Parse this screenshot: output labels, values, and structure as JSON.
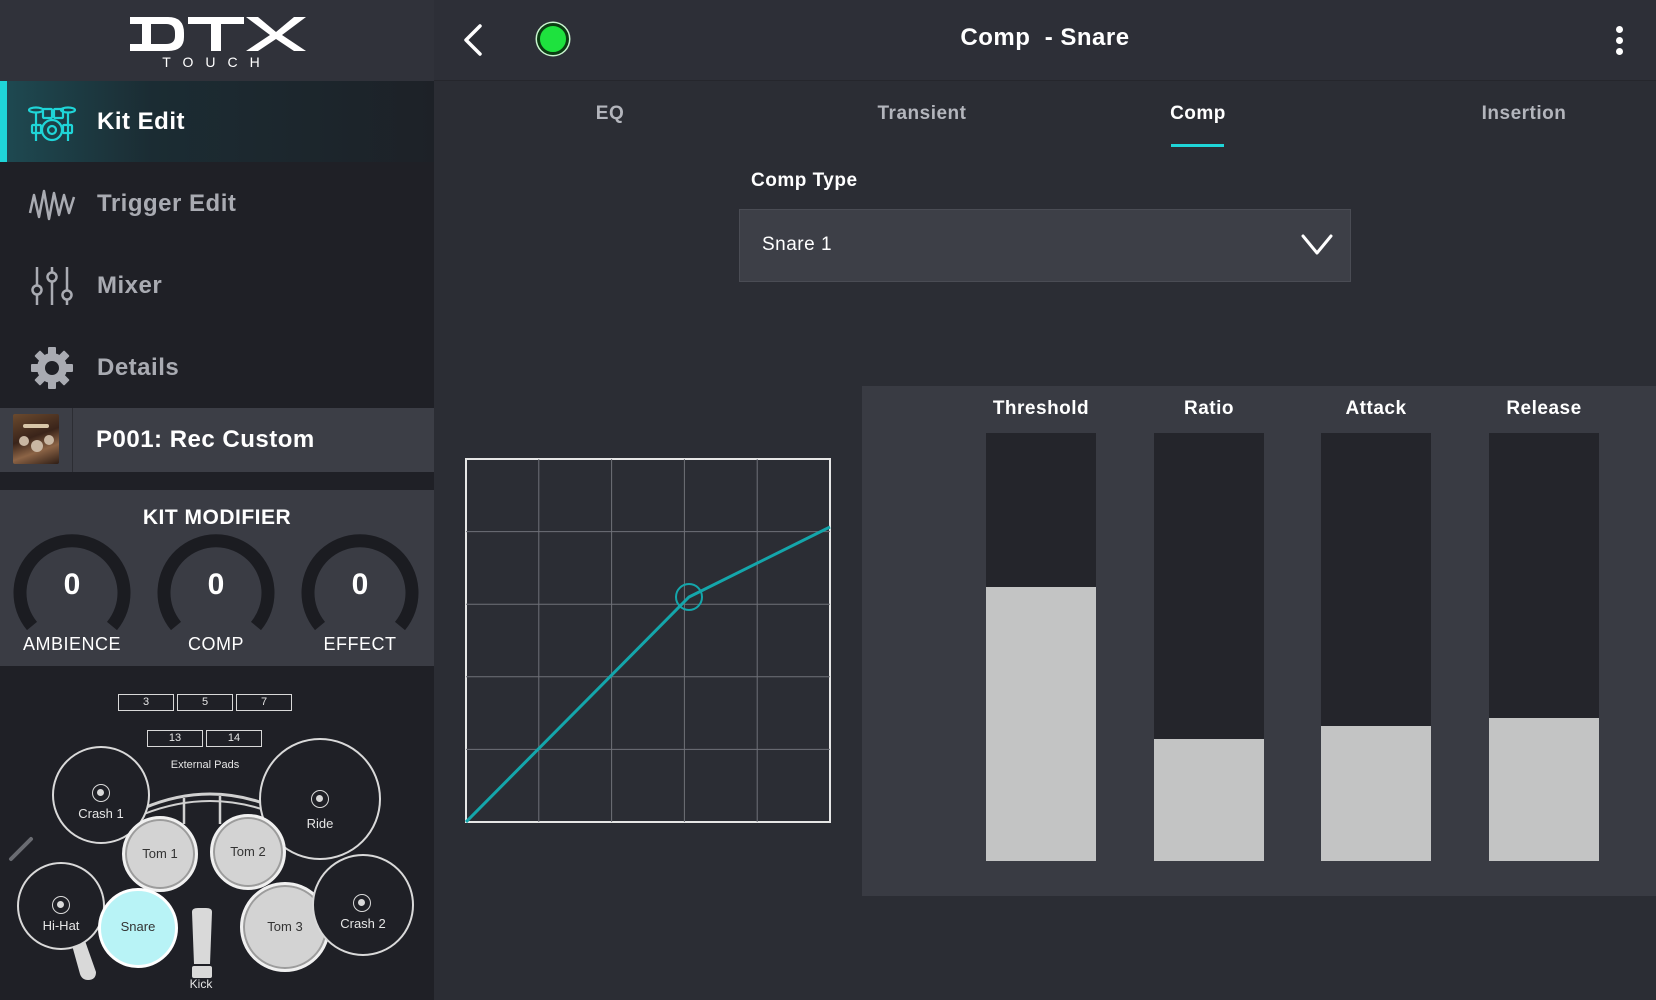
{
  "app": {
    "logo_text": "DTX",
    "logo_sub": "TOUCH"
  },
  "sidebar": {
    "items": [
      {
        "label": "Kit Edit",
        "icon": "drum-kit-icon",
        "active": true
      },
      {
        "label": "Trigger Edit",
        "icon": "waveform-icon",
        "active": false
      },
      {
        "label": "Mixer",
        "icon": "mixer-sliders-icon",
        "active": false
      },
      {
        "label": "Details",
        "icon": "gear-icon",
        "active": false
      }
    ],
    "kit": {
      "name": "P001: Rec Custom"
    },
    "kit_modifier": {
      "title": "KIT MODIFIER",
      "knobs": [
        {
          "label": "AMBIENCE",
          "value": "0"
        },
        {
          "label": "COMP",
          "value": "0"
        },
        {
          "label": "EFFECT",
          "value": "0"
        }
      ]
    },
    "pads": {
      "external_boxes_top": [
        "3",
        "5",
        "7"
      ],
      "external_boxes_bottom": [
        "13",
        "14"
      ],
      "external_label": "External Pads",
      "crash1": "Crash 1",
      "ride": "Ride",
      "tom1": "Tom 1",
      "tom2": "Tom 2",
      "hihat": "Hi-Hat",
      "snare": "Snare",
      "tom3": "Tom 3",
      "crash2": "Crash 2",
      "kick": "Kick",
      "selected": "Snare"
    }
  },
  "header": {
    "title": "Comp  - Snare",
    "status_color": "#1ee23e"
  },
  "tabs": [
    {
      "label": "EQ",
      "active": false
    },
    {
      "label": "Transient",
      "active": false
    },
    {
      "label": "Comp",
      "active": true
    },
    {
      "label": "Insertion",
      "active": false
    }
  ],
  "comp": {
    "type_label": "Comp Type",
    "type_value": "Snare 1",
    "params": [
      {
        "label": "Threshold",
        "level": 0.64
      },
      {
        "label": "Ratio",
        "level": 0.285
      },
      {
        "label": "Attack",
        "level": 0.315
      },
      {
        "label": "Release",
        "level": 0.333
      }
    ]
  },
  "colors": {
    "accent": "#1fd5d8",
    "curve": "#14a6ab",
    "snare_pad": "#b8f3f6"
  }
}
